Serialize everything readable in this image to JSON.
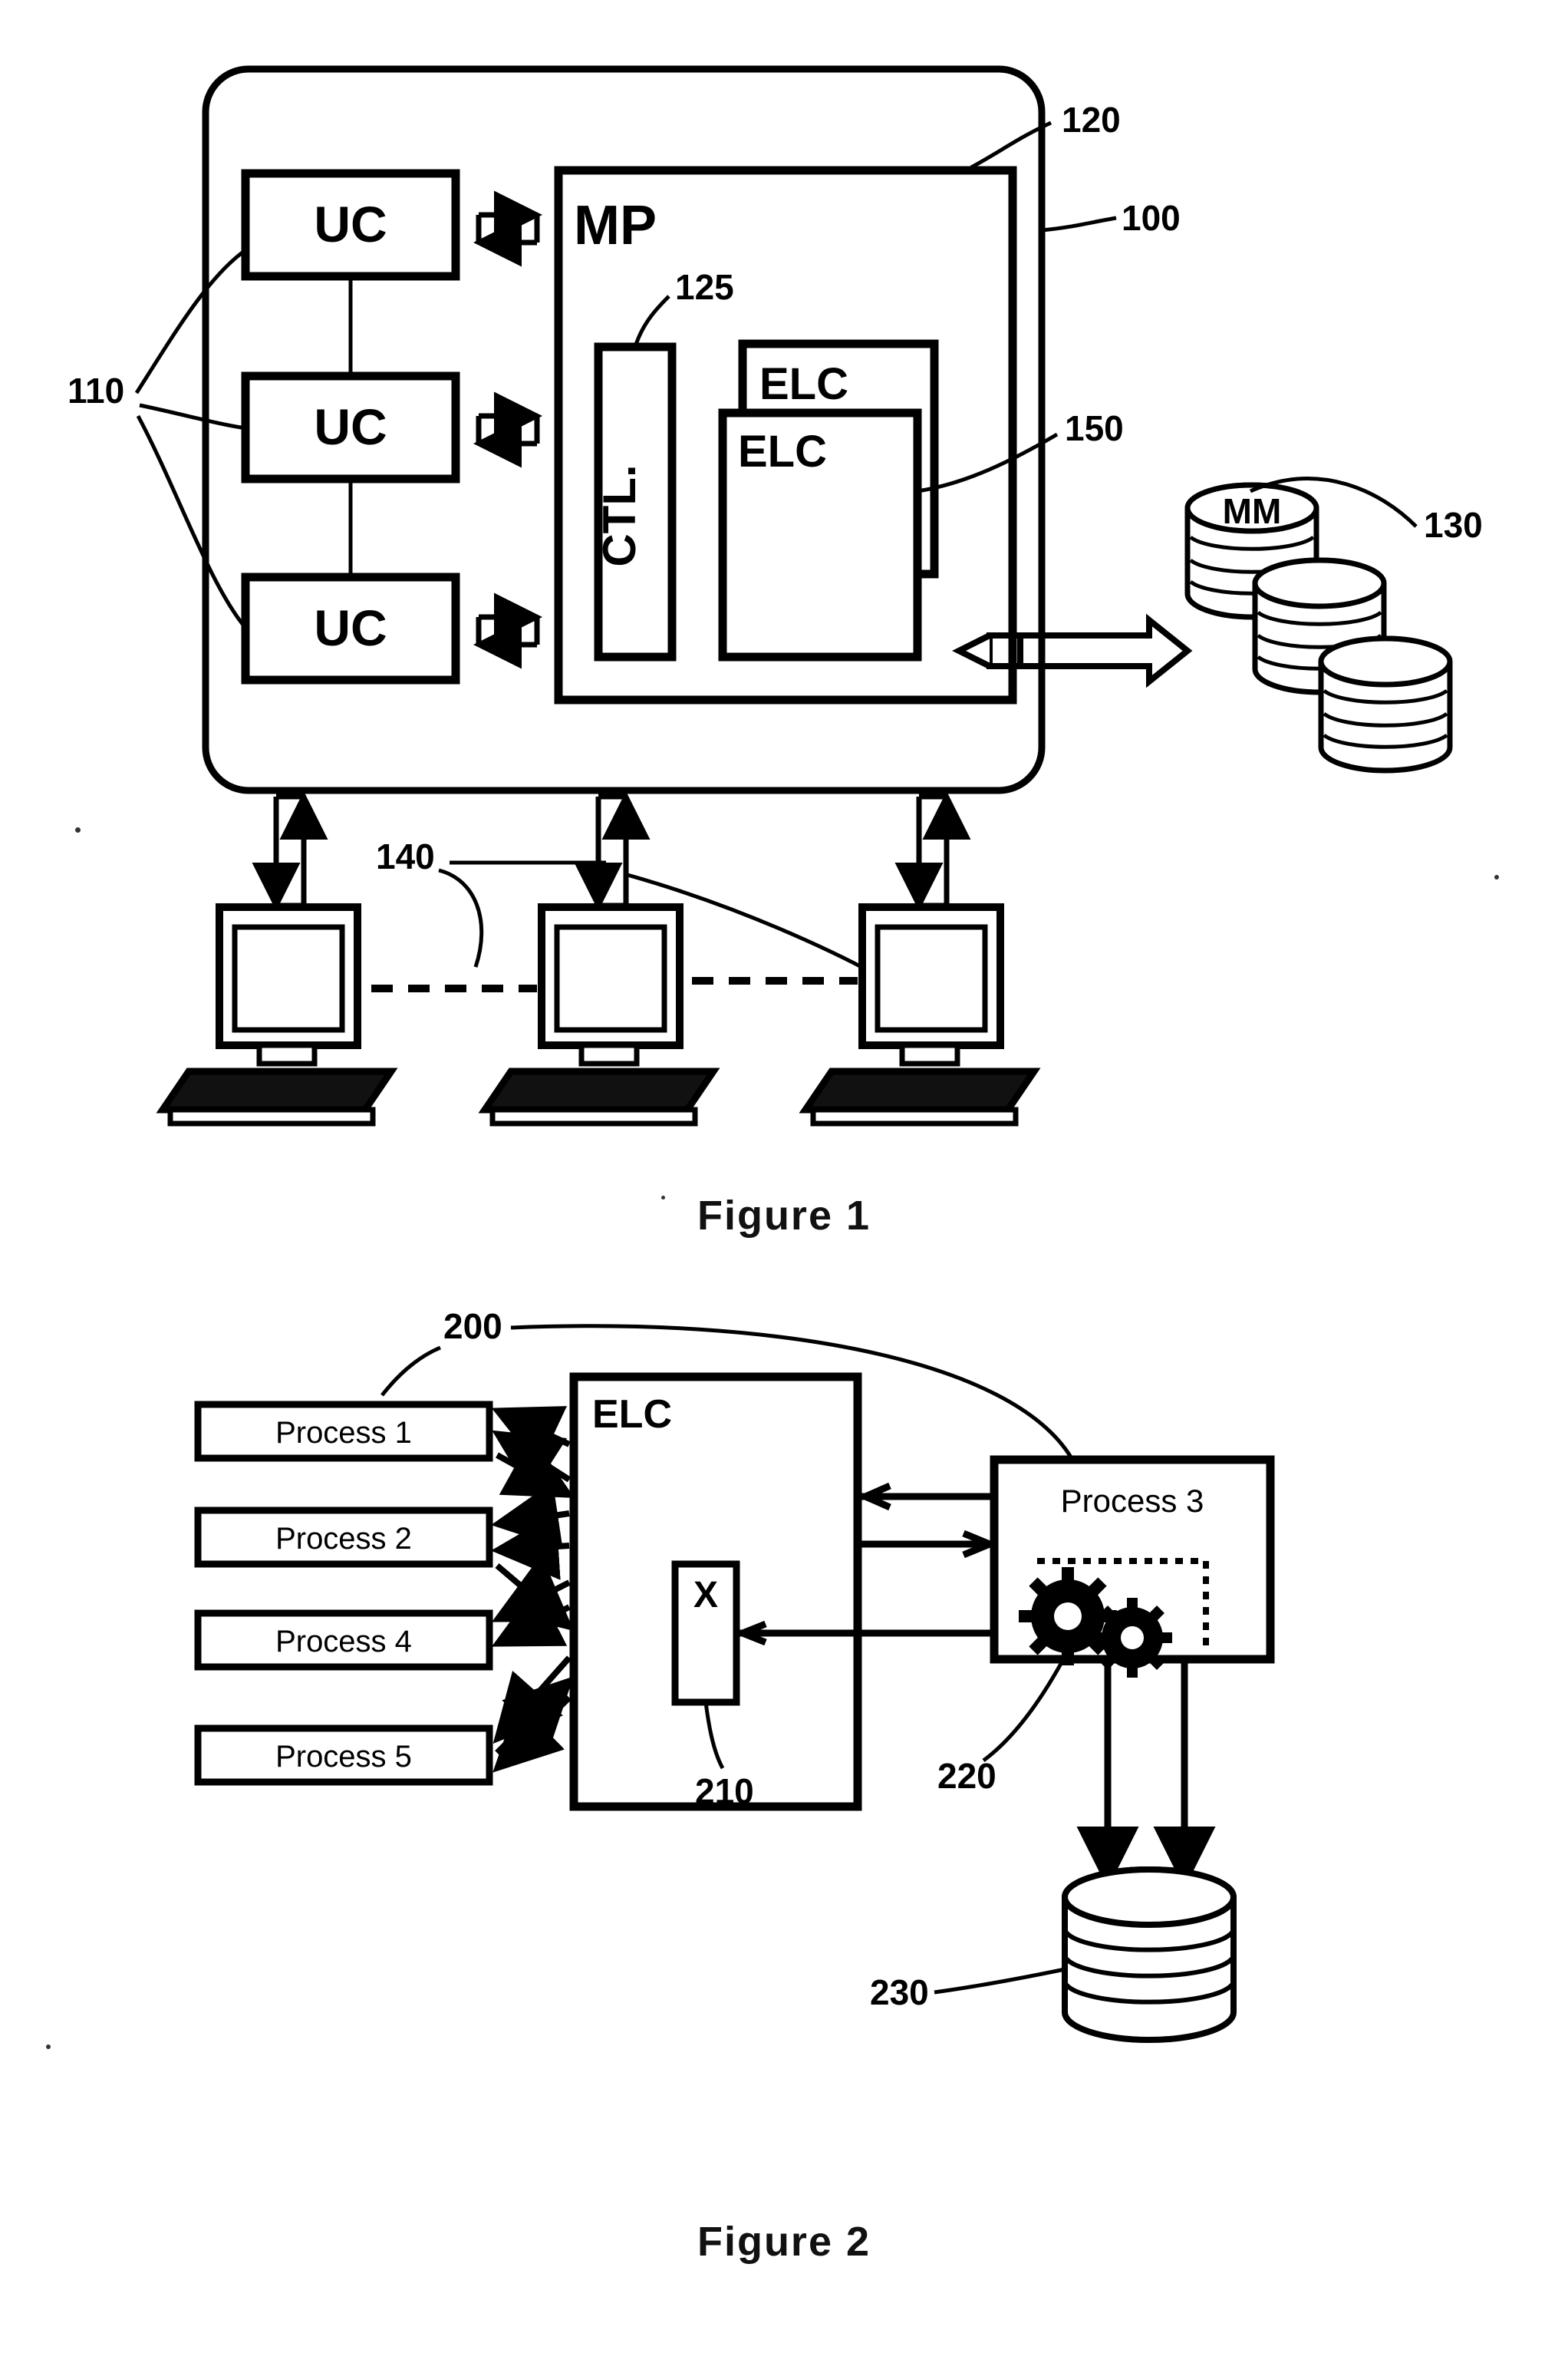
{
  "document": {
    "type": "patent-drawing-sheet",
    "figures": [
      {
        "id": "figure-1",
        "caption": "Figure 1",
        "reference_numerals": [
          {
            "label": "100",
            "refers_to": "system-enclosure"
          },
          {
            "label": "110",
            "refers_to": "uc-group"
          },
          {
            "label": "120",
            "refers_to": "mp-box"
          },
          {
            "label": "125",
            "refers_to": "ctl-box"
          },
          {
            "label": "130",
            "refers_to": "mass-memory-stack"
          },
          {
            "label": "140",
            "refers_to": "workstation-group"
          },
          {
            "label": "150",
            "refers_to": "elc-boxes"
          }
        ],
        "blocks": {
          "uc": [
            "UC",
            "UC",
            "UC"
          ],
          "mp": "MP",
          "ctl": "CTL.",
          "elc": [
            "ELC",
            "ELC"
          ],
          "memory": "MM"
        },
        "workstation_count": 3
      },
      {
        "id": "figure-2",
        "caption": "Figure 2",
        "reference_numerals": [
          {
            "label": "200",
            "refers_to": "elc-container"
          },
          {
            "label": "210",
            "refers_to": "x-box"
          },
          {
            "label": "220",
            "refers_to": "gears"
          },
          {
            "label": "230",
            "refers_to": "database-cylinder"
          }
        ],
        "blocks": {
          "elc": "ELC",
          "x": "X",
          "processes_left": [
            "Process 1",
            "Process 2",
            "Process 4",
            "Process 5"
          ],
          "process_right": "Process 3"
        }
      }
    ]
  },
  "chart_data": {
    "type": "table",
    "title": "Patent drawing sheet — Figure 1 and Figure 2",
    "figure1": {
      "caption": "Figure 1",
      "nodes": [
        {
          "name": "UC",
          "count": 3,
          "numeral": "110"
        },
        {
          "name": "MP",
          "count": 1,
          "numeral": "120"
        },
        {
          "name": "CTL.",
          "count": 1,
          "numeral": "125"
        },
        {
          "name": "ELC",
          "count": 2,
          "numeral": "150"
        },
        {
          "name": "MM",
          "count": 3,
          "numeral": "130"
        },
        {
          "name": "workstation",
          "count": 3,
          "numeral": "140"
        },
        {
          "name": "enclosure",
          "count": 1,
          "numeral": "100"
        }
      ]
    },
    "figure2": {
      "caption": "Figure 2",
      "nodes": [
        {
          "name": "ELC",
          "count": 1,
          "numeral": "200"
        },
        {
          "name": "X",
          "count": 1,
          "numeral": "210"
        },
        {
          "name": "gears",
          "count": 2,
          "numeral": "220"
        },
        {
          "name": "database",
          "count": 1,
          "numeral": "230"
        },
        {
          "name": "Process 1",
          "count": 1
        },
        {
          "name": "Process 2",
          "count": 1
        },
        {
          "name": "Process 3",
          "count": 1
        },
        {
          "name": "Process 4",
          "count": 1
        },
        {
          "name": "Process 5",
          "count": 1
        }
      ]
    }
  }
}
